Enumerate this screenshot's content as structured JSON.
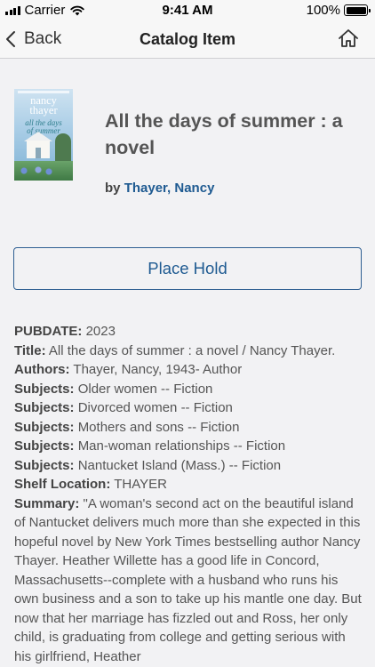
{
  "status_bar": {
    "carrier": "Carrier",
    "time": "9:41 AM",
    "battery": "100%",
    "battery_level": 1.0
  },
  "nav": {
    "back_label": "Back",
    "title": "Catalog Item",
    "home_icon": "home-icon"
  },
  "item": {
    "cover": {
      "author_line1": "nancy",
      "author_line2": "thayer",
      "title_line1": "all the days",
      "title_line2": "of summer"
    },
    "title": "All the days of summer : a novel",
    "by_prefix": "by",
    "author": "Thayer, Nancy"
  },
  "actions": {
    "place_hold_label": "Place Hold"
  },
  "details": [
    {
      "label": "PUBDATE:",
      "value": "2023"
    },
    {
      "label": "Title:",
      "value": "All the days of summer : a novel / Nancy Thayer."
    },
    {
      "label": "Authors:",
      "value": "Thayer, Nancy, 1943- Author"
    },
    {
      "label": "Subjects:",
      "value": "Older women -- Fiction"
    },
    {
      "label": "Subjects:",
      "value": "Divorced women -- Fiction"
    },
    {
      "label": "Subjects:",
      "value": "Mothers and sons -- Fiction"
    },
    {
      "label": "Subjects:",
      "value": "Man-woman relationships -- Fiction"
    },
    {
      "label": "Subjects:",
      "value": "Nantucket Island (Mass.) -- Fiction"
    },
    {
      "label": "Shelf Location:",
      "value": "THAYER"
    },
    {
      "label": "Summary:",
      "value": "\"A woman's second act on the beautiful island of Nantucket delivers much more than she expected in this hopeful novel by New York Times bestselling author Nancy Thayer. Heather Willette has a good life in Concord, Massachusetts--complete with a husband who runs his own business and a son to take up his mantle one day. But now that her marriage has fizzled out and Ross, her only child, is graduating from college and getting serious with his girlfriend, Heather"
    }
  ],
  "colors": {
    "link": "#1e5a91",
    "background": "#f2f2f4",
    "bar": "#f7f7f7"
  }
}
